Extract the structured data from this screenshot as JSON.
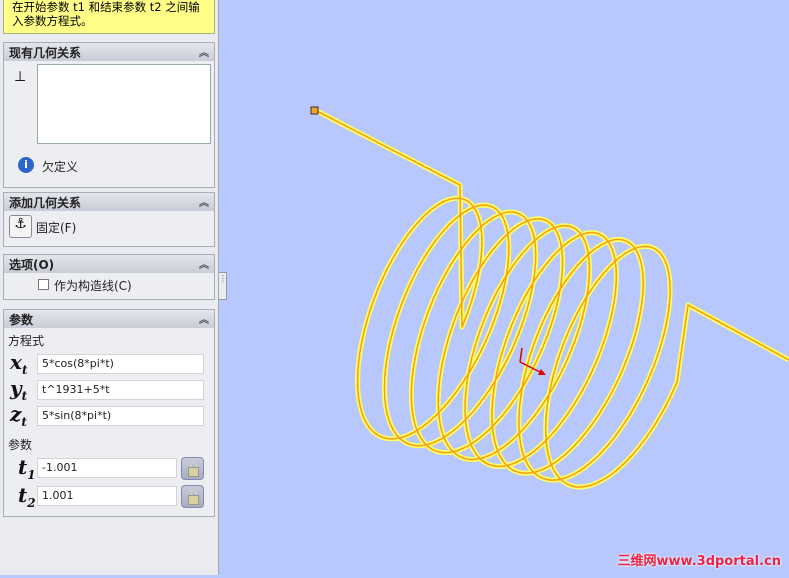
{
  "hint": "在开始参数 t1 和结束参数 t2 之间输入参数方程式。",
  "existing": {
    "title": "现有几何关系",
    "status": "欠定义"
  },
  "add": {
    "title": "添加几何关系",
    "fix": "固定(F)"
  },
  "options": {
    "title": "选项(O)",
    "construction": "作为构造线(C)",
    "construction_checked": false
  },
  "params": {
    "title": "参数",
    "equations_label": "方程式",
    "xt": "5*cos(8*pi*t)",
    "yt": "t^1931+5*t",
    "zt": "5*sin(8*pi*t)",
    "param_label": "参数",
    "t1": "-1.001",
    "t2": "1.001",
    "x_sym": "x",
    "y_sym": "y",
    "z_sym": "z",
    "t_sym": "t",
    "sub1": "1",
    "sub2": "2"
  },
  "watermark": "三维网www.3dportal.cn",
  "colors": {
    "viewport": "#b8c8fc",
    "curve": "#f5a623",
    "glow": "#ffff60"
  }
}
